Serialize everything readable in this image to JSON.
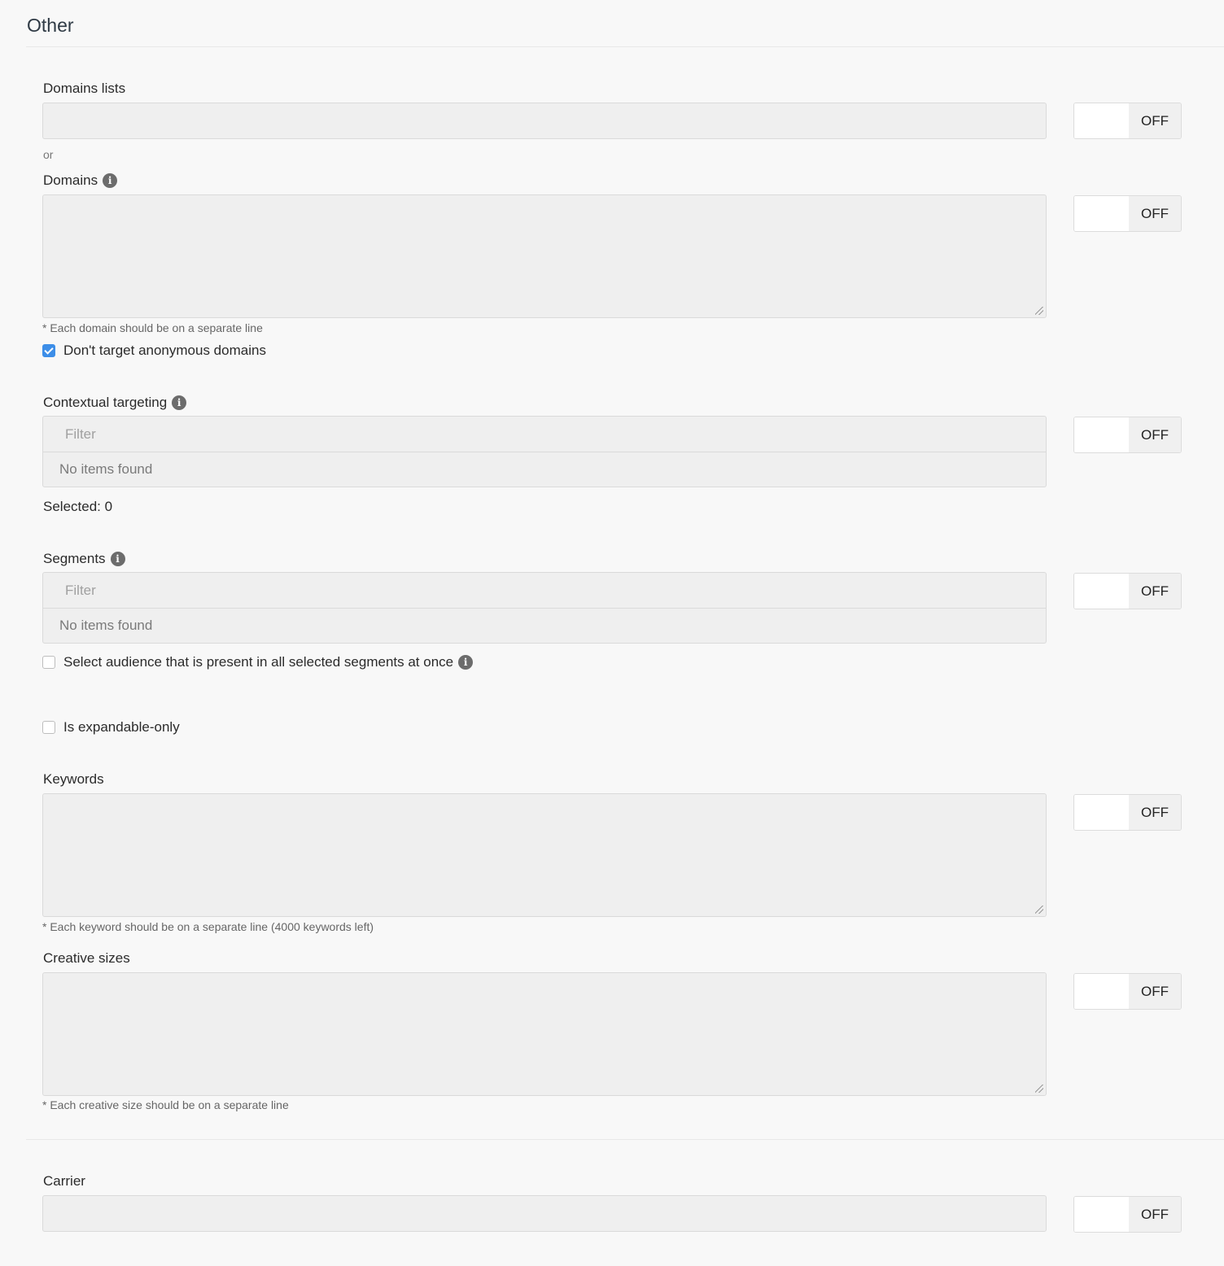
{
  "section": {
    "title": "Other"
  },
  "toggle_state": "OFF",
  "domains_lists": {
    "label": "Domains lists",
    "value": ""
  },
  "or_text": "or",
  "domains": {
    "label": "Domains",
    "info_icon": "info-icon",
    "value": "",
    "hint": "* Each domain should be on a separate line",
    "checkbox_label": "Don't target anonymous domains",
    "checkbox_checked": true
  },
  "contextual": {
    "label": "Contextual targeting",
    "filter_placeholder": "Filter",
    "empty_text": "No items found",
    "selected_text": "Selected: 0"
  },
  "segments": {
    "label": "Segments",
    "filter_placeholder": "Filter",
    "empty_text": "No items found",
    "checkbox_label": "Select audience that is present in all selected segments at once",
    "checkbox_checked": false
  },
  "expandable": {
    "label": "Is expandable-only",
    "checked": false
  },
  "keywords": {
    "label": "Keywords",
    "value": "",
    "hint": "* Each keyword should be on a separate line (4000 keywords left)"
  },
  "creative_sizes": {
    "label": "Creative sizes",
    "value": "",
    "hint": "* Each creative size should be on a separate line"
  },
  "carrier": {
    "label": "Carrier",
    "value": ""
  },
  "colors": {
    "checkbox_accent": "#3d8ee8",
    "background": "#f8f8f8",
    "field": "#efefef"
  }
}
